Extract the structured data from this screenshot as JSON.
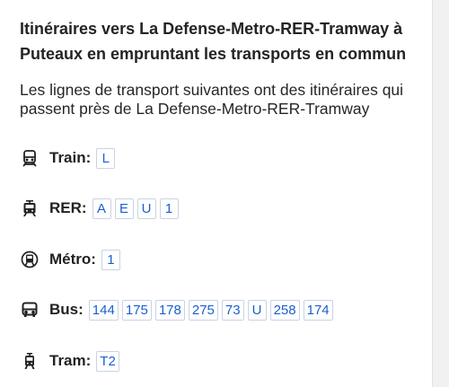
{
  "title": "Itinéraires vers La Defense-Metro-RER-Tramway à Puteaux en empruntant les transports en commun",
  "description": "Les lignes de transport suivantes ont des itinéraires qui passent près de La Defense-Metro-RER-Tramway",
  "modes": [
    {
      "icon": "train-icon",
      "label": "Train:",
      "lines": [
        "L"
      ]
    },
    {
      "icon": "rer-icon",
      "label": "RER:",
      "lines": [
        "A",
        "E",
        "U",
        "1"
      ]
    },
    {
      "icon": "metro-icon",
      "label": "Métro:",
      "lines": [
        "1"
      ]
    },
    {
      "icon": "bus-icon",
      "label": "Bus:",
      "lines": [
        "144",
        "175",
        "178",
        "275",
        "73",
        "U",
        "258",
        "174"
      ]
    },
    {
      "icon": "tram-icon",
      "label": "Tram:",
      "lines": [
        "T2"
      ]
    }
  ],
  "colors": {
    "link": "#1a5fd1",
    "badge_border": "#c9d3e4",
    "text": "#222222"
  }
}
